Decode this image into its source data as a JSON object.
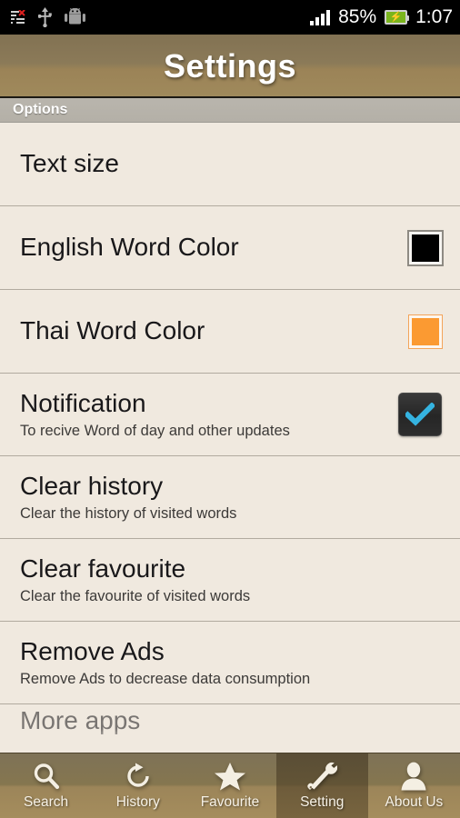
{
  "status_bar": {
    "left_icons": [
      "sync-disabled-icon",
      "usb-icon",
      "android-robot-icon"
    ],
    "signal_icon": "signal-bars-icon",
    "battery_percent": "85%",
    "battery_icon": "battery-charging-icon",
    "clock": "1:07"
  },
  "header": {
    "title": "Settings"
  },
  "section": {
    "label": "Options"
  },
  "colors": {
    "background": "#f0e9df",
    "header_brown": "#9b8357",
    "section_gray": "#b4b0a7",
    "divider": "#b1aa9f",
    "english_word_swatch": "#000000",
    "thai_word_swatch": "#fb9a32",
    "checkbox_check": "#35b3e0",
    "checkbox_box": "#2a2a2a",
    "tab_active_bg": "#4b3c22",
    "tab_label": "#f6f1e6"
  },
  "settings": [
    {
      "name": "text-size",
      "title": "Text size",
      "subtitle": "",
      "accessory": "none"
    },
    {
      "name": "english-word-color",
      "title": "English Word Color",
      "subtitle": "",
      "accessory": "color-swatch",
      "swatch_color": "#000000"
    },
    {
      "name": "thai-word-color",
      "title": "Thai Word Color",
      "subtitle": "",
      "accessory": "color-swatch",
      "swatch_color": "#fb9a32"
    },
    {
      "name": "notification",
      "title": "Notification",
      "subtitle": "To recive Word of day and other updates",
      "accessory": "checkbox",
      "checked": true
    },
    {
      "name": "clear-history",
      "title": "Clear history",
      "subtitle": "Clear the history of visited words",
      "accessory": "none"
    },
    {
      "name": "clear-favourite",
      "title": "Clear favourite",
      "subtitle": "Clear the favourite of visited words",
      "accessory": "none"
    },
    {
      "name": "remove-ads",
      "title": "Remove Ads",
      "subtitle": "Remove Ads to decrease data consumption",
      "accessory": "none"
    },
    {
      "name": "more-apps",
      "title": "More apps",
      "subtitle": "",
      "accessory": "none"
    }
  ],
  "tabs": [
    {
      "name": "search",
      "label": "Search",
      "icon": "magnifier-icon",
      "active": false
    },
    {
      "name": "history",
      "label": "History",
      "icon": "refresh-arrow-icon",
      "active": false
    },
    {
      "name": "favourite",
      "label": "Favourite",
      "icon": "star-icon",
      "active": false
    },
    {
      "name": "setting",
      "label": "Setting",
      "icon": "tools-icon",
      "active": true
    },
    {
      "name": "about-us",
      "label": "About Us",
      "icon": "person-icon",
      "active": false
    }
  ]
}
